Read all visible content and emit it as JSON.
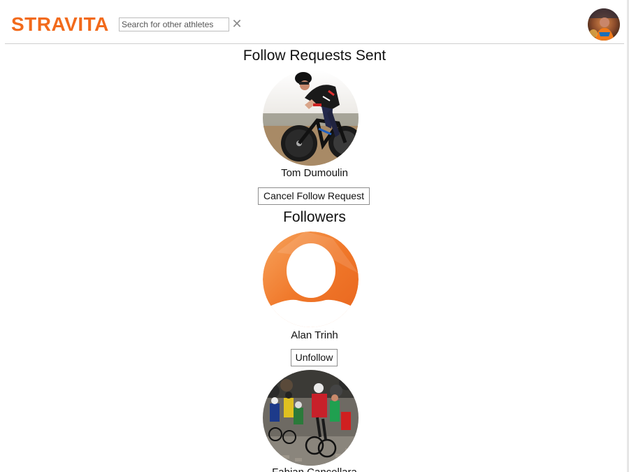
{
  "header": {
    "logo_text": "STRAVITA",
    "search_placeholder": "Search for other athletes",
    "clear_symbol": "✕",
    "avatar_icon": "user-avatar-icon"
  },
  "follow_requests": {
    "title": "Follow Requests Sent",
    "items": [
      {
        "name": "Tom Dumoulin",
        "button_label": "Cancel Follow Request",
        "photo_icon": "cyclist-time-trial-photo"
      }
    ]
  },
  "followers": {
    "title": "Followers",
    "items": [
      {
        "name": "Alan Trinh",
        "button_label": "Unfollow",
        "photo_icon": "default-avatar-icon"
      },
      {
        "name": "Fabian Cancellara",
        "photo_icon": "cyclist-race-photo"
      }
    ]
  },
  "colors": {
    "brand": "#f26a1b",
    "divider": "#cfcfcf",
    "button_border": "#8d8d8d"
  }
}
